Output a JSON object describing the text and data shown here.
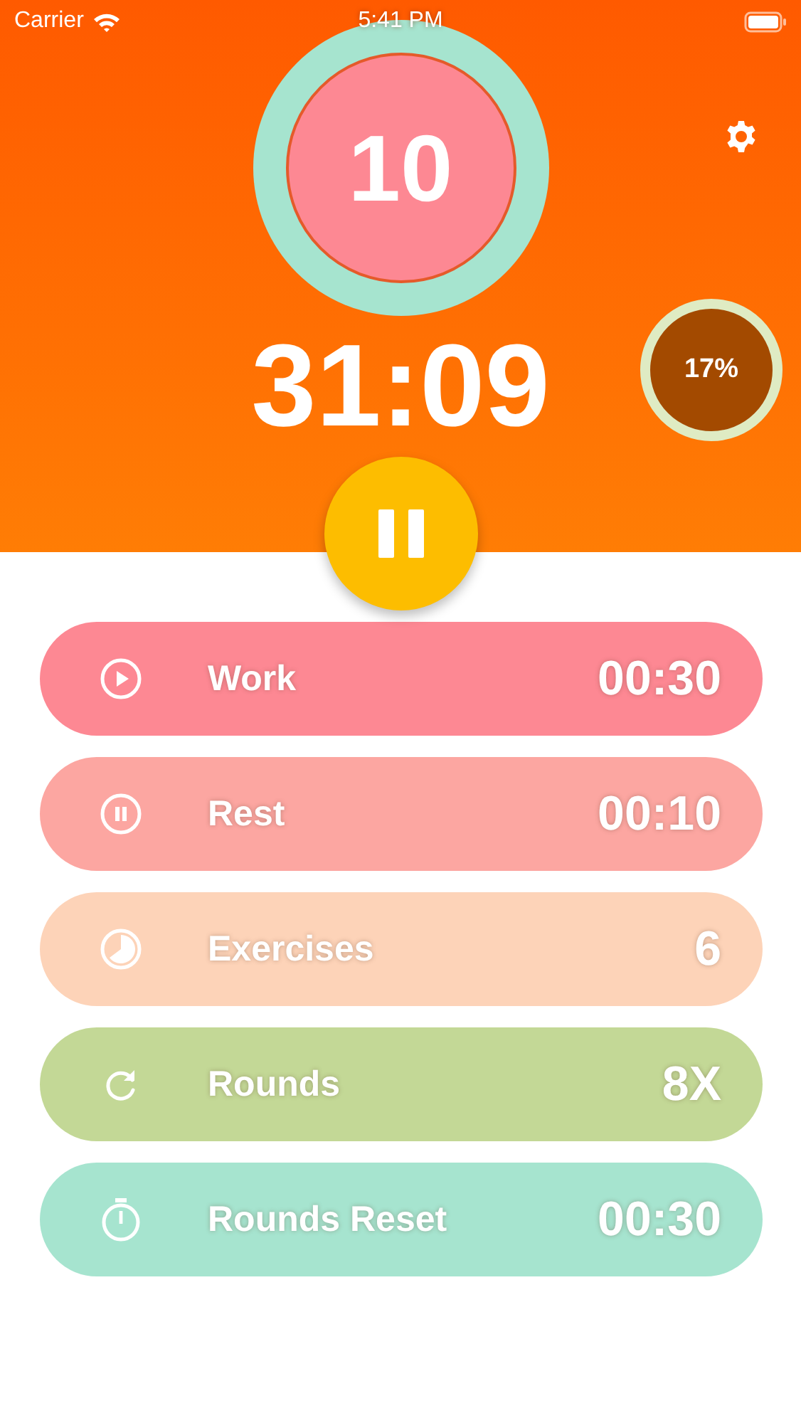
{
  "status_bar": {
    "carrier": "Carrier",
    "time": "5:41 PM"
  },
  "timer": {
    "count": "10",
    "elapsed": "31:09",
    "progress_label": "17%"
  },
  "settings": [
    {
      "kind": "play",
      "label": "Work",
      "value": "00:30",
      "color": "#fd8893"
    },
    {
      "kind": "pause",
      "label": "Rest",
      "value": "00:10",
      "color": "#fca6a1"
    },
    {
      "kind": "pie",
      "label": "Exercises",
      "value": "6",
      "color": "#fdd3b8"
    },
    {
      "kind": "repeat",
      "label": "Rounds",
      "value": "8X",
      "color": "#c3d896"
    },
    {
      "kind": "stopwatch",
      "label": "Rounds Reset",
      "value": "00:30",
      "color": "#a6e4cf"
    }
  ]
}
